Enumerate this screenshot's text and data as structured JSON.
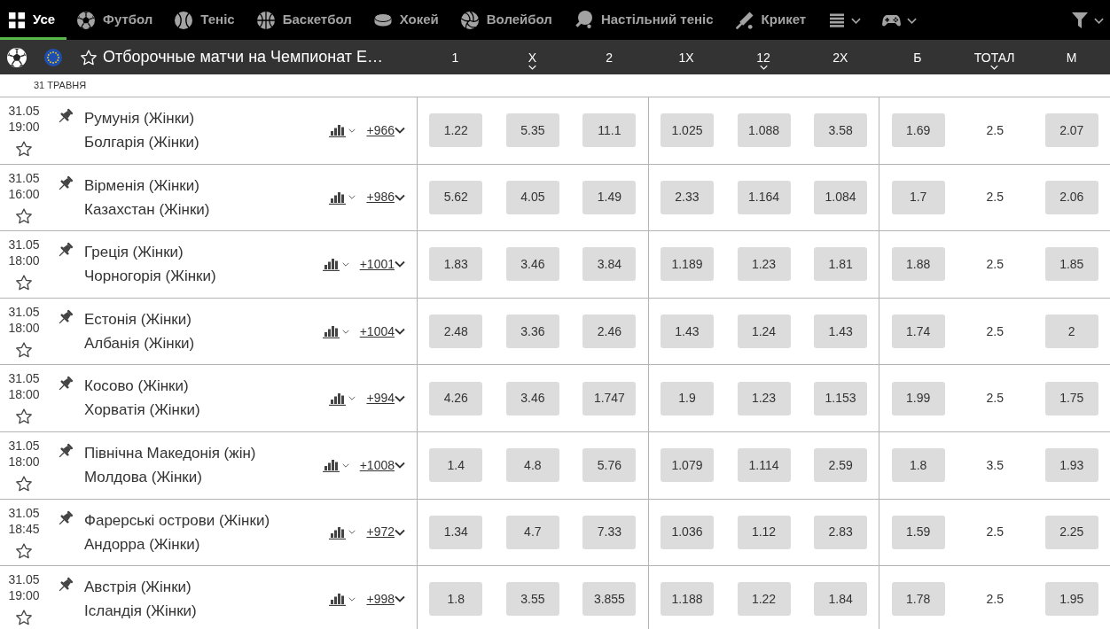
{
  "sports_nav": {
    "tabs": [
      {
        "label": "Усе",
        "kind": "all",
        "selected": true
      },
      {
        "label": "Футбол",
        "kind": "football",
        "selected": false
      },
      {
        "label": "Теніс",
        "kind": "tennis",
        "selected": false
      },
      {
        "label": "Баскетбол",
        "kind": "basketball",
        "selected": false
      },
      {
        "label": "Хокей",
        "kind": "hockey",
        "selected": false
      },
      {
        "label": "Волейбол",
        "kind": "volleyball",
        "selected": false
      },
      {
        "label": "Настільний теніс",
        "kind": "table_tennis",
        "selected": false
      },
      {
        "label": "Крикет",
        "kind": "cricket",
        "selected": false
      }
    ]
  },
  "league": {
    "title": "Отборочные матчи на Чемпионат Е…",
    "favorite": false
  },
  "columns": [
    {
      "label": "1",
      "kind": "odds",
      "dropdown": false
    },
    {
      "label": "X",
      "kind": "odds",
      "dropdown": true
    },
    {
      "label": "2",
      "kind": "odds",
      "dropdown": false
    },
    {
      "label": "1X",
      "kind": "odds",
      "dropdown": false
    },
    {
      "label": "12",
      "kind": "odds",
      "dropdown": true
    },
    {
      "label": "2X",
      "kind": "odds",
      "dropdown": false
    },
    {
      "label": "Б",
      "kind": "odds",
      "dropdown": false
    },
    {
      "label": "ТОТАЛ",
      "kind": "line",
      "dropdown": true
    },
    {
      "label": "М",
      "kind": "odds",
      "dropdown": false
    }
  ],
  "date_group": "31 ТРАВНЯ",
  "matches": [
    {
      "date": "31.05",
      "time": "19:00",
      "favorite": false,
      "home": "Румунія (Жінки)",
      "away": "Болгарія (Жінки)",
      "more_bets": "+966",
      "odds": [
        "1.22",
        "5.35",
        "11.1",
        "1.025",
        "1.088",
        "3.58",
        "1.69",
        "2.5",
        "2.07"
      ]
    },
    {
      "date": "31.05",
      "time": "16:00",
      "favorite": false,
      "home": "Вірменія (Жінки)",
      "away": "Казахстан (Жінки)",
      "more_bets": "+986",
      "odds": [
        "5.62",
        "4.05",
        "1.49",
        "2.33",
        "1.164",
        "1.084",
        "1.7",
        "2.5",
        "2.06"
      ]
    },
    {
      "date": "31.05",
      "time": "18:00",
      "favorite": false,
      "home": "Греція (Жінки)",
      "away": "Чорногорія (Жінки)",
      "more_bets": "+1001",
      "odds": [
        "1.83",
        "3.46",
        "3.84",
        "1.189",
        "1.23",
        "1.81",
        "1.88",
        "2.5",
        "1.85"
      ]
    },
    {
      "date": "31.05",
      "time": "18:00",
      "favorite": false,
      "home": "Естонія (Жінки)",
      "away": "Албанія (Жінки)",
      "more_bets": "+1004",
      "odds": [
        "2.48",
        "3.36",
        "2.46",
        "1.43",
        "1.24",
        "1.43",
        "1.74",
        "2.5",
        "2"
      ]
    },
    {
      "date": "31.05",
      "time": "18:00",
      "favorite": false,
      "home": "Косово (Жінки)",
      "away": "Хорватія (Жінки)",
      "more_bets": "+994",
      "odds": [
        "4.26",
        "3.46",
        "1.747",
        "1.9",
        "1.23",
        "1.153",
        "1.99",
        "2.5",
        "1.75"
      ]
    },
    {
      "date": "31.05",
      "time": "18:00",
      "favorite": false,
      "home": "Північна Македонія (жін)",
      "away": "Молдова (Жінки)",
      "more_bets": "+1008",
      "odds": [
        "1.4",
        "4.8",
        "5.76",
        "1.079",
        "1.114",
        "2.59",
        "1.8",
        "3.5",
        "1.93"
      ]
    },
    {
      "date": "31.05",
      "time": "18:45",
      "favorite": false,
      "home": "Фарерські острови (Жінки)",
      "away": "Андорра (Жінки)",
      "more_bets": "+972",
      "odds": [
        "1.34",
        "4.7",
        "7.33",
        "1.036",
        "1.12",
        "2.83",
        "1.59",
        "2.5",
        "2.25"
      ]
    },
    {
      "date": "31.05",
      "time": "19:00",
      "favorite": false,
      "home": "Австрія (Жінки)",
      "away": "Ісландія (Жінки)",
      "more_bets": "+998",
      "odds": [
        "1.8",
        "3.55",
        "3.855",
        "1.188",
        "1.22",
        "1.84",
        "1.78",
        "2.5",
        "1.95"
      ]
    }
  ]
}
